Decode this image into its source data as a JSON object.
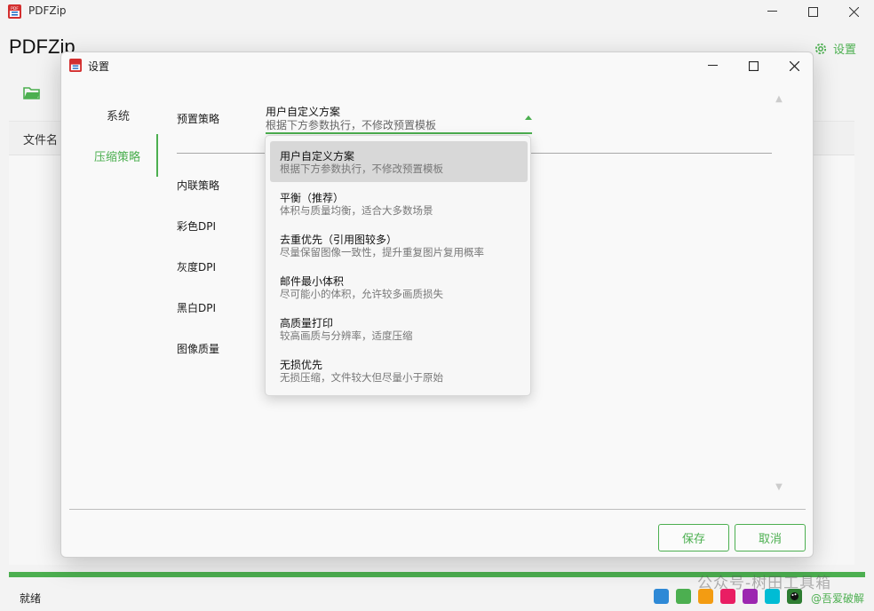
{
  "app": {
    "title": "PDFZip",
    "header_title": "PDFZip",
    "settings_label": "设置",
    "file_column": "文件名",
    "status": "就绪",
    "watermark": "公众号-树田工具箱",
    "credit": "@吾爱破解",
    "accent_color": "#4caf50",
    "swatch_colors": [
      "#2e89d6",
      "#4caf50",
      "#f39c12",
      "#e91e63",
      "#9c27b0",
      "#00bcd4",
      "#2e7d32"
    ]
  },
  "dialog": {
    "title": "设置",
    "nav": [
      "系统",
      "压缩策略"
    ],
    "active_nav": "压缩策略",
    "fields": {
      "preset": "预置策略",
      "inline": "内联策略",
      "color_dpi": "彩色DPI",
      "gray_dpi": "灰度DPI",
      "mono_dpi": "黑白DPI",
      "image_quality": "图像质量"
    },
    "combo": {
      "selected_title": "用户自定义方案",
      "selected_desc": "根据下方参数执行，不修改预置模板"
    },
    "dropdown_options": [
      {
        "title": "用户自定义方案",
        "desc": "根据下方参数执行，不修改预置模板"
      },
      {
        "title": "平衡（推荐）",
        "desc": "体积与质量均衡，适合大多数场景"
      },
      {
        "title": "去重优先（引用图较多）",
        "desc": "尽量保留图像一致性，提升重复图片复用概率"
      },
      {
        "title": "邮件最小体积",
        "desc": "尽可能小的体积，允许较多画质损失"
      },
      {
        "title": "高质量打印",
        "desc": "较高画质与分辨率，适度压缩"
      },
      {
        "title": "无损优先",
        "desc": "无损压缩，文件较大但尽量小于原始"
      }
    ],
    "save_label": "保存",
    "cancel_label": "取消"
  }
}
